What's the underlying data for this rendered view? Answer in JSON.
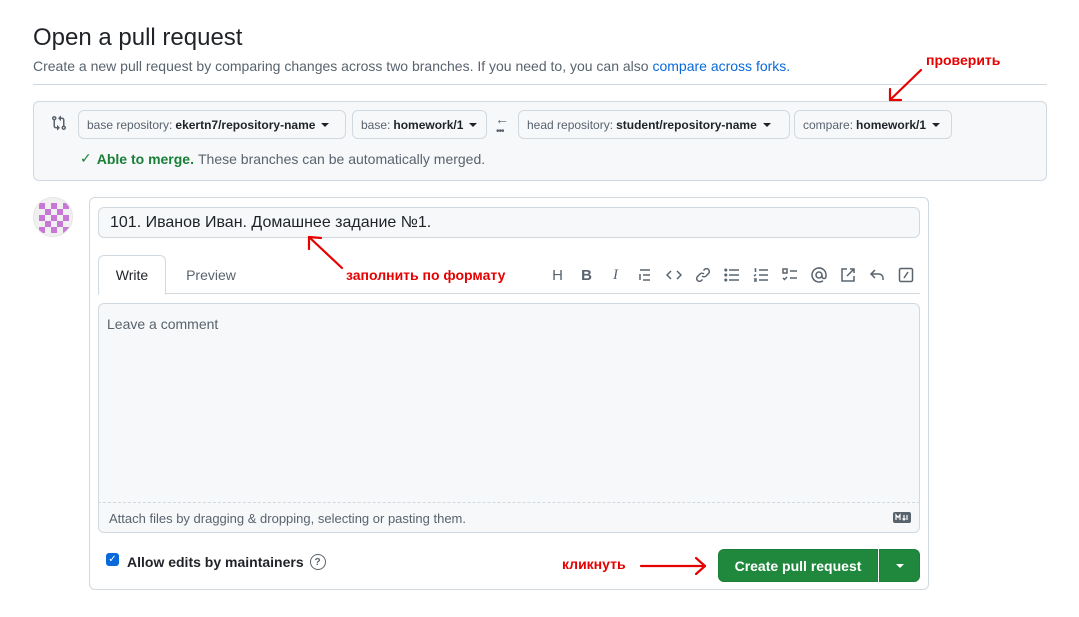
{
  "header": {
    "title": "Open a pull request",
    "subtitle": "Create a new pull request by comparing changes across two branches. If you need to, you can also ",
    "subtitle_link": "compare across forks."
  },
  "range": {
    "base_repo_label": "base repository:",
    "base_repo_value": "ekertn7/repository-name",
    "base_label": "base:",
    "base_value": "homework/1",
    "head_repo_label": "head repository:",
    "head_repo_value": "student/repository-name",
    "compare_label": "compare:",
    "compare_value": "homework/1",
    "merge_ok": "Able to merge.",
    "merge_text": "These branches can be automatically merged."
  },
  "form": {
    "title_value": "101. Иванов Иван. Домашнее задание №1.",
    "tab_write": "Write",
    "tab_preview": "Preview",
    "comment_placeholder": "Leave a comment",
    "attach_text": "Attach files by dragging & dropping, selecting or pasting them.",
    "allow_edits": "Allow edits by maintainers",
    "create_button": "Create pull request"
  },
  "toolbar": {
    "heading": "H",
    "bold": "B",
    "italic": "I"
  },
  "annotations": {
    "check": "проверить",
    "fill_format": "заполнить по формату",
    "click": "кликнуть"
  },
  "colors": {
    "annotation": "#e60000",
    "primary_button": "#1f883d",
    "link": "#0969da",
    "success": "#1a7f37"
  }
}
